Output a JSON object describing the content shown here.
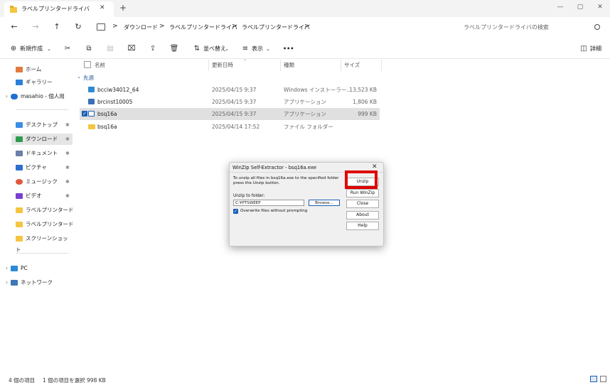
{
  "tab": {
    "title": "ラベルプリンタードライバ",
    "close": "✕",
    "new": "+"
  },
  "window": {
    "minimize": "—",
    "maximize": "▢",
    "close": "✕"
  },
  "nav": {
    "back": "←",
    "forward": "→",
    "up": "↑",
    "refresh": "↻",
    "sep": ">"
  },
  "breadcrumb": [
    "ダウンロード",
    "ラベルプリンタードライバ",
    "ラベルプリンタードライバ"
  ],
  "search": {
    "placeholder": "ラベルプリンタードライバの検索"
  },
  "toolbar": {
    "new_label": "新規作成",
    "sort_label": "並べ替え",
    "view_label": "表示",
    "more": "•••",
    "details_label": "詳細"
  },
  "sidebar": {
    "home": "ホーム",
    "gallery": "ギャラリー",
    "onedrive": "masahio - 個人用",
    "desktop": "デスクトップ",
    "downloads": "ダウンロード",
    "documents": "ドキュメント",
    "pictures": "ピクチャ",
    "music": "ミュージック",
    "videos": "ビデオ",
    "folder1": "ラベルプリンタードラ",
    "folder2": "ラベルプリンタードライバ",
    "folder3": "スクリーンショット",
    "pc": "PC",
    "network": "ネットワーク"
  },
  "columns": {
    "name": "名前",
    "modified": "更新日時",
    "type": "種類",
    "size": "サイズ"
  },
  "group_label": "先週",
  "files": [
    {
      "name": "bcciw34012_64",
      "modified": "2025/04/15 9:37",
      "type": "Windows インストーラー...",
      "size": "13,523 KB",
      "icon": "installer-icon"
    },
    {
      "name": "brcinst10005",
      "modified": "2025/04/15 9:37",
      "type": "アプリケーション",
      "size": "1,806 KB",
      "icon": "app-icon"
    },
    {
      "name": "bsq16a",
      "modified": "2025/04/15 9:37",
      "type": "アプリケーション",
      "size": "999 KB",
      "icon": "app-icon"
    },
    {
      "name": "bsq16a",
      "modified": "2025/04/14 17:52",
      "type": "ファイル フォルダー",
      "size": "",
      "icon": "folder-icon"
    }
  ],
  "dialog": {
    "title": "WinZip Self-Extractor - bsq16a.exe",
    "close": "✕",
    "message": "To unzip all files in bsq16a.exe to the specified folder press the Unzip button.",
    "folder_label": "Unzip to folder:",
    "folder_value": "C:¥PTSWEEP",
    "browse": "Browse...",
    "overwrite_label": "Overwrite files without prompting",
    "unzip": "Unzip",
    "run_winzip": "Run WinZip",
    "close_btn": "Close",
    "about": "About",
    "help": "Help"
  },
  "status": {
    "count": "4 個の項目",
    "selected": "1 個の項目を選択  998 KB"
  },
  "colors": {
    "highlight": "#e00000",
    "selection": "#e0e0e0",
    "checkbox": "#1a5fb4"
  }
}
